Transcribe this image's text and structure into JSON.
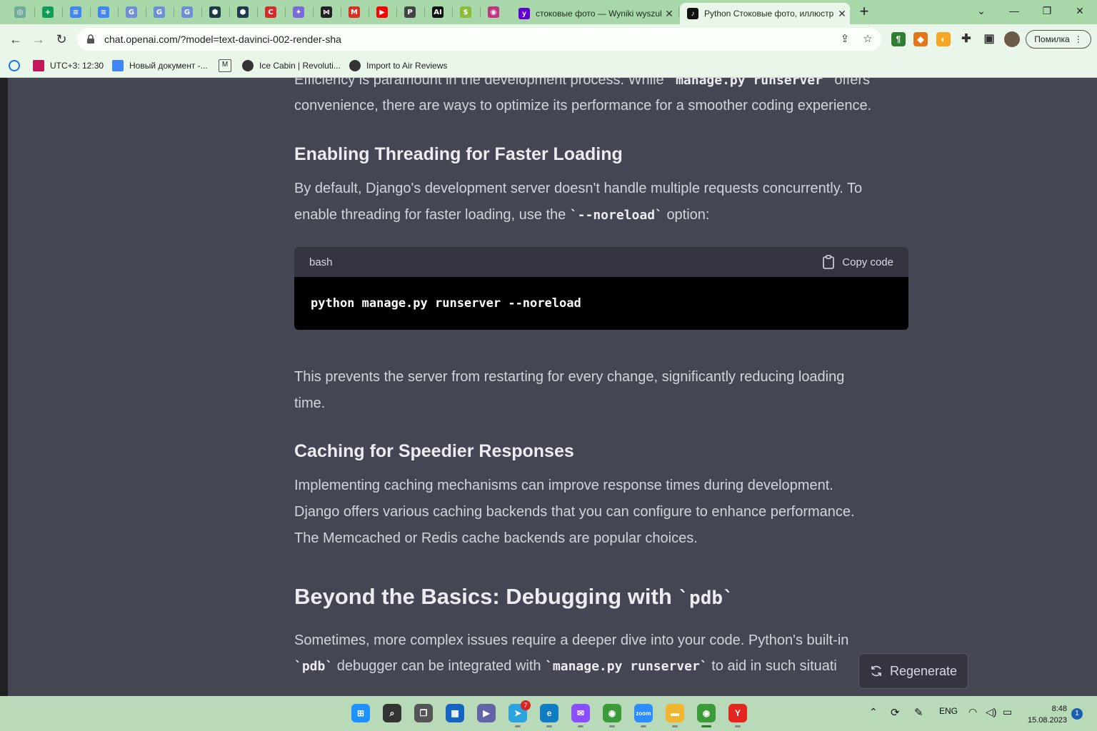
{
  "browser": {
    "tabs": [
      {
        "title": "стоковые фото — Wyniki wyszuk",
        "icon": "yahoo-icon",
        "color": "#6001d2",
        "active": false
      },
      {
        "title": "Python Стоковые фото, иллюстр",
        "icon": "tiktok-icon",
        "color": "#111111",
        "active": true
      }
    ],
    "pinned_tabs": [
      {
        "icon": "chatgpt-icon",
        "color": "#74aa9c",
        "glyph": "◎"
      },
      {
        "icon": "sheets-icon",
        "color": "#0f9d58",
        "glyph": "+"
      },
      {
        "icon": "docs-icon",
        "color": "#4285f4",
        "glyph": "≡"
      },
      {
        "icon": "docs-icon",
        "color": "#4285f4",
        "glyph": "≡"
      },
      {
        "icon": "translate-icon",
        "color": "#6d8fd8",
        "glyph": "G"
      },
      {
        "icon": "translate-icon",
        "color": "#6d8fd8",
        "glyph": "G"
      },
      {
        "icon": "translate-icon",
        "color": "#6d8fd8",
        "glyph": "G"
      },
      {
        "icon": "hexagon-icon",
        "color": "#1d3a4a",
        "glyph": "⬢"
      },
      {
        "icon": "hexagon-icon",
        "color": "#1d3a4a",
        "glyph": "⬢"
      },
      {
        "icon": "copyright-icon",
        "color": "#d42a2a",
        "glyph": "C"
      },
      {
        "icon": "sparkle-icon",
        "color": "#7a6bd8",
        "glyph": "✦"
      },
      {
        "icon": "bowtie-icon",
        "color": "#222222",
        "glyph": "⋈"
      },
      {
        "icon": "gmail-icon",
        "color": "#d93025",
        "glyph": "M"
      },
      {
        "icon": "youtube-icon",
        "color": "#ff0000",
        "glyph": "▶"
      },
      {
        "icon": "p-icon",
        "color": "#444444",
        "glyph": "P"
      },
      {
        "icon": "ai-icon",
        "color": "#111111",
        "glyph": "AI"
      },
      {
        "icon": "dollar-icon",
        "color": "#8bbd3a",
        "glyph": "$"
      },
      {
        "icon": "circle-icon",
        "color": "#c13584",
        "glyph": "◉"
      }
    ],
    "url": "chat.openai.com/?model=text-davinci-002-render-sha",
    "error_label": "Помилка",
    "bookmarks": [
      {
        "label": "",
        "icon": "settings-gear-icon",
        "color": "#1a73e8"
      },
      {
        "label": "UTC+3: 12:30",
        "icon": "l-icon",
        "color": "#c2185b"
      },
      {
        "label": "Новый документ -...",
        "icon": "docs-icon",
        "color": "#4285f4"
      },
      {
        "label": "",
        "icon": "m-logo-icon",
        "color": "#555555"
      },
      {
        "label": "Ice Cabin | Revoluti...",
        "icon": "globe-icon",
        "color": "#333333"
      },
      {
        "label": "Import to Air Reviews",
        "icon": "globe-icon",
        "color": "#333333"
      }
    ]
  },
  "article": {
    "intro_part1": "Efficiency is paramount in the development process. While",
    "intro_code": "`manage.py runserver`",
    "intro_part2": "offers",
    "intro_line2": "convenience, there are ways to optimize its performance for a smoother coding experience.",
    "h_threading": "Enabling Threading for Faster Loading",
    "threading_line1": "By default, Django's development server doesn't handle multiple requests concurrently. To",
    "threading_line2_a": "enable threading for faster loading, use the",
    "threading_line2_code": "`--noreload`",
    "threading_line2_b": "option:",
    "code_lang": "bash",
    "copy_label": "Copy code",
    "code": "python manage.py runserver --noreload",
    "after_code_line1": "This prevents the server from restarting for every change, significantly reducing loading",
    "after_code_line2": "time.",
    "h_caching": "Caching for Speedier Responses",
    "caching_line1": "Implementing caching mechanisms can improve response times during development.",
    "caching_line2": "Django offers various caching backends that you can configure to enhance performance.",
    "caching_line3": "The Memcached or Redis cache backends are popular choices.",
    "h_debug": "Beyond the Basics: Debugging with",
    "h_debug_code": "`pdb`",
    "debug_line1": "Sometimes, more complex issues require a deeper dive into your code. Python's built-in",
    "debug_line2_code1": "`pdb`",
    "debug_line2_a": "debugger can be integrated with",
    "debug_line2_code2": "`manage.py runserver`",
    "debug_line2_b": "to aid in such situati",
    "regenerate_label": "Regenerate"
  },
  "taskbar": {
    "apps": [
      {
        "icon": "windows-start-icon",
        "color": "#1e90ff",
        "glyph": "⊞"
      },
      {
        "icon": "search-icon",
        "color": "#333333",
        "glyph": "⌕"
      },
      {
        "icon": "task-view-icon",
        "color": "#555555",
        "glyph": "❐"
      },
      {
        "icon": "widgets-icon",
        "color": "#1565c0",
        "glyph": "▦"
      },
      {
        "icon": "teams-chat-icon",
        "color": "#6264a7",
        "glyph": "▶"
      },
      {
        "icon": "telegram-icon",
        "color": "#2aa3de",
        "glyph": "➤",
        "badge": "7"
      },
      {
        "icon": "edge-icon",
        "color": "#0f7cc4",
        "glyph": "e"
      },
      {
        "icon": "messenger-icon",
        "color": "#8a4dff",
        "glyph": "✉"
      },
      {
        "icon": "chrome-icon",
        "color": "#3b9b3b",
        "glyph": "◉"
      },
      {
        "icon": "zoom-icon",
        "color": "#2d8cff",
        "glyph": "zoom"
      },
      {
        "icon": "file-explorer-icon",
        "color": "#f2b530",
        "glyph": "▬"
      },
      {
        "icon": "chrome-icon",
        "color": "#3b9b3b",
        "glyph": "◉"
      },
      {
        "icon": "yandex-browser-icon",
        "color": "#e52620",
        "glyph": "Y"
      }
    ],
    "language": "ENG",
    "time": "8:48",
    "date": "15.08.2023",
    "notifications": "1"
  }
}
